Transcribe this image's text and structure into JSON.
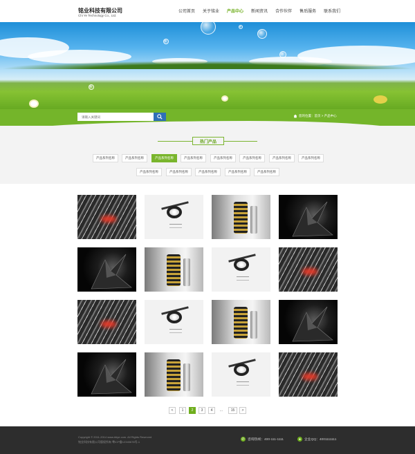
{
  "header": {
    "logo_title": "铭业科技有限公司",
    "logo_subtitle": "Chi Ye Technology Co., Ltd.",
    "nav": [
      "公司首页",
      "关于铭业",
      "产品中心",
      "新闻资讯",
      "合作伙伴",
      "售后服务",
      "联系我们"
    ],
    "nav_active_index": 2
  },
  "search": {
    "placeholder": "请输入关键词",
    "button_icon": "search-icon"
  },
  "breadcrumb": {
    "icon": "home-icon",
    "text": "您的位置：首页 > 产品中心"
  },
  "categories": {
    "title": "热门产品",
    "row1": [
      "产品系列名称",
      "产品系列名称",
      "产品系列名称",
      "产品系列名称",
      "产品系列名称",
      "产品系列名称",
      "产品系列名称",
      "产品系列名称"
    ],
    "row2": [
      "产品系列名称",
      "产品系列名称",
      "产品系列名称",
      "产品系列名称",
      "产品系列名称"
    ],
    "selected_row1_index": 2
  },
  "products": [
    [
      "keyboard",
      "eye",
      "metal",
      "black"
    ],
    [
      "black",
      "metal",
      "eye",
      "keyboard"
    ],
    [
      "keyboard",
      "eye",
      "metal",
      "black"
    ],
    [
      "black",
      "metal",
      "eye",
      "keyboard"
    ]
  ],
  "pagination": {
    "prev": "<",
    "pages": [
      "1",
      "2",
      "3",
      "4",
      "...",
      "15"
    ],
    "current": "2",
    "next": ">"
  },
  "footer": {
    "copyright": "Copyright © 2011-2014 www.##ye.com. All Rights Reserved",
    "icp": "铭业科技有限公司版权所有 粤ICP备12345678号-1",
    "hotline_label": "咨询热线：400-111-1111",
    "qq_label": "企业QQ：4001111111",
    "colors": {
      "accent": "#6fae1d",
      "footer_bg": "#2d2d2d"
    }
  }
}
